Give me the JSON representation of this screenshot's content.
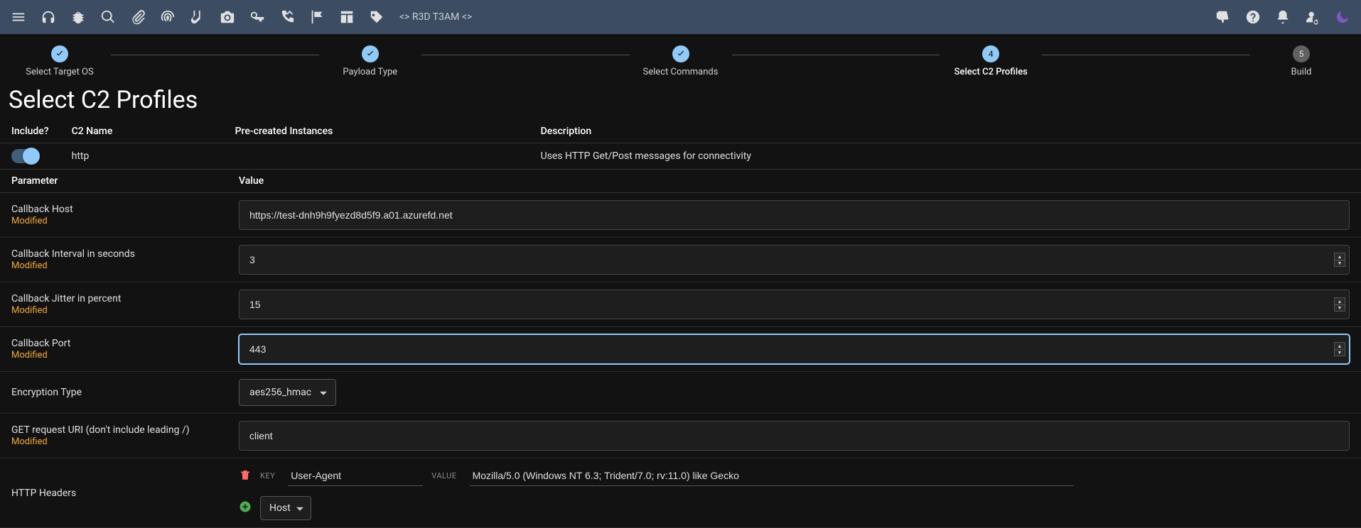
{
  "topbar": {
    "team_label": "<> R3D T3AM <>",
    "icons_left": [
      "menu",
      "headphones",
      "bug",
      "search",
      "attach",
      "fingerprint",
      "socks",
      "camera",
      "key",
      "phone-missed",
      "flag",
      "layout",
      "tag"
    ],
    "icons_right": [
      "thumbs-down",
      "help",
      "bell",
      "user-cog",
      "moon"
    ]
  },
  "stepper": {
    "steps": [
      {
        "label": "Select Target OS",
        "state": "done"
      },
      {
        "label": "Payload Type",
        "state": "done"
      },
      {
        "label": "Select Commands",
        "state": "done"
      },
      {
        "label": "Select C2 Profiles",
        "state": "current",
        "number": "4"
      },
      {
        "label": "Build",
        "state": "pending",
        "number": "5"
      }
    ]
  },
  "page": {
    "title": "Select C2 Profiles"
  },
  "c2_table": {
    "headers": {
      "include": "Include?",
      "name": "C2 Name",
      "instances": "Pre-created Instances",
      "description": "Description"
    },
    "row": {
      "include_on": true,
      "name": "http",
      "description": "Uses HTTP Get/Post messages for connectivity"
    }
  },
  "param_table": {
    "headers": {
      "parameter": "Parameter",
      "value": "Value"
    },
    "modified_label": "Modified",
    "params": {
      "callback_host": {
        "label": "Callback Host",
        "modified": true,
        "value": "https://test-dnh9h9fyezd8d5f9.a01.azurefd.net"
      },
      "callback_interval": {
        "label": "Callback Interval in seconds",
        "modified": true,
        "value": "3"
      },
      "callback_jitter": {
        "label": "Callback Jitter in percent",
        "modified": true,
        "value": "15"
      },
      "callback_port": {
        "label": "Callback Port",
        "modified": true,
        "value": "443"
      },
      "encryption_type": {
        "label": "Encryption Type",
        "modified": false,
        "value": "aes256_hmac"
      },
      "get_uri": {
        "label": "GET request URI (don't include leading /)",
        "modified": true,
        "value": "client"
      },
      "http_headers": {
        "label": "HTTP Headers"
      }
    },
    "headers_editor": {
      "key_label": "KEY",
      "value_label": "VALUE",
      "entry": {
        "key": "User-Agent",
        "value": "Mozilla/5.0 (Windows NT 6.3; Trident/7.0; rv:11.0) like Gecko"
      },
      "new_key_selected": "Host"
    }
  }
}
